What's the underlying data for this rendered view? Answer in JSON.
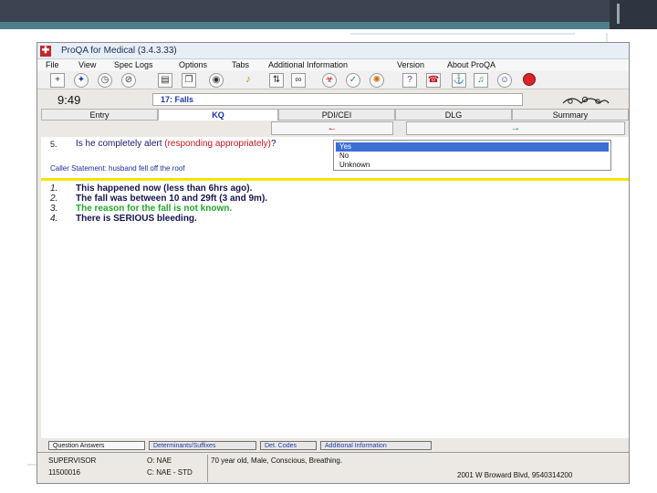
{
  "window": {
    "title": "ProQA for Medical (3.4.3.33)"
  },
  "menu": [
    "File",
    "View",
    "Spec Logs",
    "Options",
    "Tabs",
    "Additional Information",
    "Version",
    "About ProQA"
  ],
  "toolbar": {
    "icons": [
      "add-icon",
      "star-icon",
      "clock-icon",
      "cancel-icon",
      "document-icon",
      "copy-icon",
      "eye-icon",
      "lamp-icon",
      "sort-icon",
      "binoculars-icon",
      "biohazard-icon",
      "ok-icon",
      "alarm-icon",
      "help-icon",
      "phone-icon",
      "anchor-icon",
      "hearing-icon",
      "smile-icon",
      "stop-icon"
    ]
  },
  "clock": "9:49",
  "protocol": "17: Falls",
  "tabs": [
    "Entry",
    "KQ",
    "PDI/CEI",
    "DLG",
    "Summary"
  ],
  "active_tab": "KQ",
  "nav": {
    "back_arrow": "←",
    "forward_arrow": "→"
  },
  "question": {
    "number": "5.",
    "text": "Is he completely alert ",
    "hint": "(responding appropriately)",
    "suffix": "?"
  },
  "answers": [
    "Yes",
    "No",
    "Unknown"
  ],
  "selected_answer": "Yes",
  "caller_statement": "Caller Statement: husband fell off the roof",
  "key_questions": [
    {
      "num": "1.",
      "text": "This happened now (less than 6hrs ago).",
      "color": "#141450"
    },
    {
      "num": "2.",
      "text": "The fall was between 10 and 29ft (3 and 9m).",
      "color": "#141450"
    },
    {
      "num": "3.",
      "text": "The reason for the fall is not known.",
      "color": "#23a62b"
    },
    {
      "num": "4.",
      "text": "There is SERIOUS bleeding.",
      "color": "#141450"
    }
  ],
  "bottom_tabs": [
    "Question Answers",
    "Determinants/Suffixes",
    "Det. Codes",
    "Additional Information"
  ],
  "status": {
    "role": "SUPERVISOR",
    "id": "11500016",
    "code1": "O: NAE",
    "code2": "C: NAE - STD",
    "summary": "70 year old, Male, Conscious, Breathing.",
    "address": "2001 W Broward Blvd, 9540314200"
  },
  "colors": {
    "teal_accent": "#4f7f8b",
    "dark_header": "#3d4451",
    "highlight": "#f4e400"
  }
}
